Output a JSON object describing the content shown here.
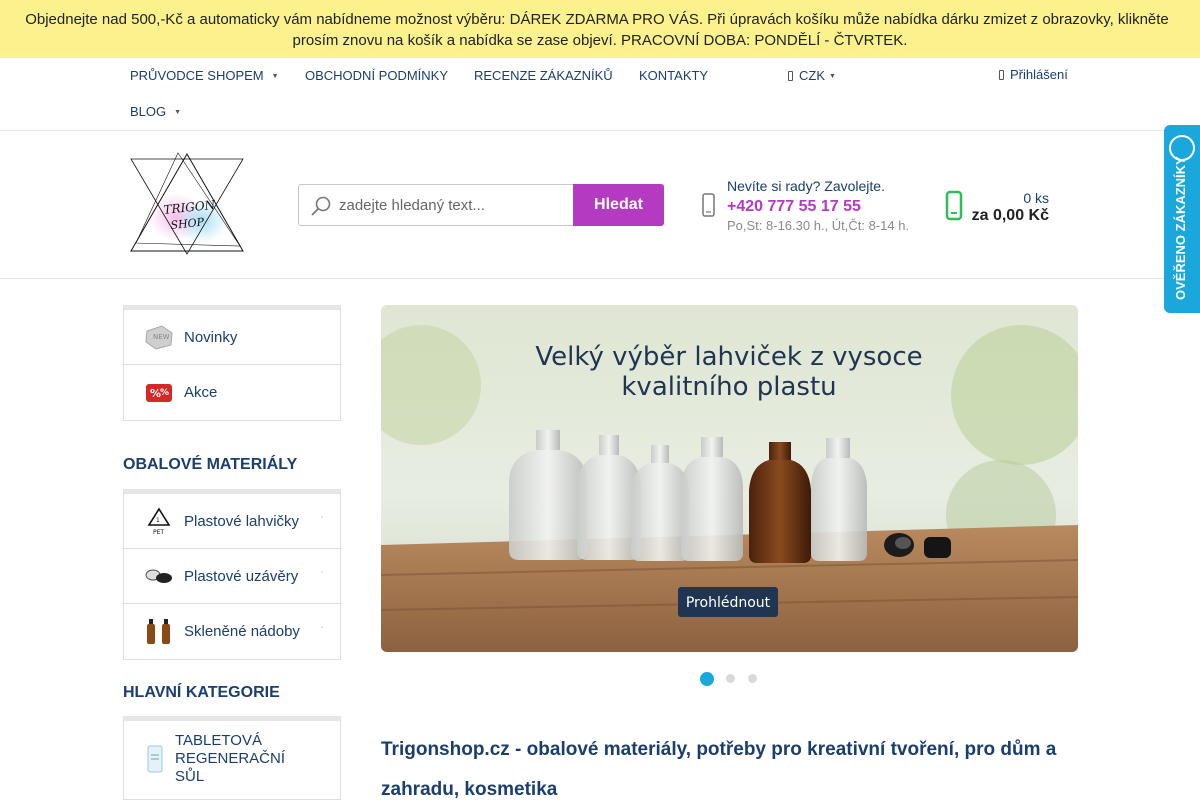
{
  "announcement": {
    "line1": "Objednejte nad 500,-Kč a automaticky vám nabídneme možnost výběru: DÁREK ZDARMA PRO VÁS. Při úpravách košíku může nabídka dárku zmizet z obrazovky, klikněte",
    "line2": "prosím znovu na košík a nabídka se zase objeví. PRACOVNÍ DOBA: PONDĚLÍ - ČTVRTEK."
  },
  "nav": {
    "items": [
      "PRŮVODCE SHOPEM",
      "OBCHODNÍ PODMÍNKY",
      "RECENZE ZÁKAZNÍKŮ",
      "KONTAKTY",
      "BLOG"
    ],
    "currency": "CZK",
    "login": "Přihlášení"
  },
  "header": {
    "logo_text_1": "TRIGON",
    "logo_text_2": "SHOP",
    "search_placeholder": "zadejte hledaný text...",
    "search_button": "Hledat",
    "help_text": "Nevíte si rady? Zavolejte.",
    "phone": "+420 777 55 17 55",
    "hours": "Po,St: 8-16.30 h., Út,Čt: 8-14 h.",
    "cart_count": "0 ks",
    "cart_total": "za 0,00 Kč"
  },
  "verified_badge": "OVĚŘENO ZÁKAZNÍKY",
  "sidebar": {
    "quick_links": [
      {
        "label": "Novinky",
        "icon": "new-icon"
      },
      {
        "label": "Akce",
        "icon": "sale-icon"
      }
    ],
    "section1_title": "OBALOVÉ MATERIÁLY",
    "section1_items": [
      {
        "label": "Plastové lahvičky",
        "icon": "pet-recycle-icon"
      },
      {
        "label": "Plastové uzávěry",
        "icon": "caps-icon"
      },
      {
        "label": "Skleněné nádoby",
        "icon": "glass-bottles-icon"
      }
    ],
    "section2_title": "HLAVNÍ KATEGORIE",
    "section2_items": [
      {
        "label": "TABLETOVÁ REGENERAČNÍ SŮL",
        "icon": "salt-icon"
      }
    ]
  },
  "banner": {
    "headline_1": "Velký výběr lahviček z vysoce",
    "headline_2": "kvalitního plastu",
    "cta": "Prohlédnout",
    "slide_count": 3,
    "active_slide": 1
  },
  "page_heading": "Trigonshop.cz - obalové materiály, potřeby pro kreativní tvoření, pro dům a zahradu, kosmetika",
  "colors": {
    "announce_bg": "#fbf28e",
    "brand_purple": "#b53ac2",
    "navy": "#1a3e6e",
    "accent_blue": "#19a7dc",
    "cart_green": "#2ebd59"
  }
}
